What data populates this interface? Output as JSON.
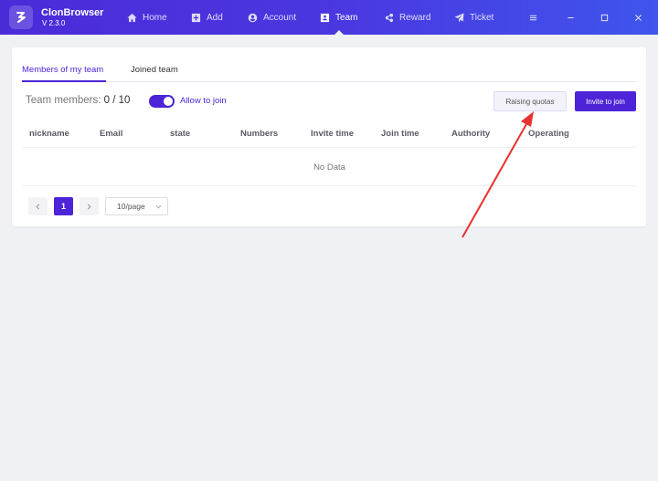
{
  "app": {
    "name": "ClonBrowser",
    "version": "V 2.3.0"
  },
  "nav": {
    "home": "Home",
    "add": "Add",
    "account": "Account",
    "team": "Team",
    "reward": "Reward",
    "ticket": "Ticket"
  },
  "tabs": {
    "members": "Members of my team",
    "joined": "Joined team"
  },
  "team": {
    "members_label": "Team members: ",
    "members_count": "0 / 10",
    "allow_join_label": "Allow to join",
    "allow_join_enabled": true
  },
  "buttons": {
    "raising_quotas": "Raising quotas",
    "invite": "Invite to join"
  },
  "table": {
    "columns": [
      "nickname",
      "Email",
      "state",
      "Numbers",
      "Invite time",
      "Join time",
      "Authority",
      "Operating"
    ],
    "empty_text": "No Data"
  },
  "pagination": {
    "current_page": "1",
    "page_size": "10/page"
  },
  "colors": {
    "accent": "#4d24d8",
    "annotation_arrow": "#e8322f"
  }
}
